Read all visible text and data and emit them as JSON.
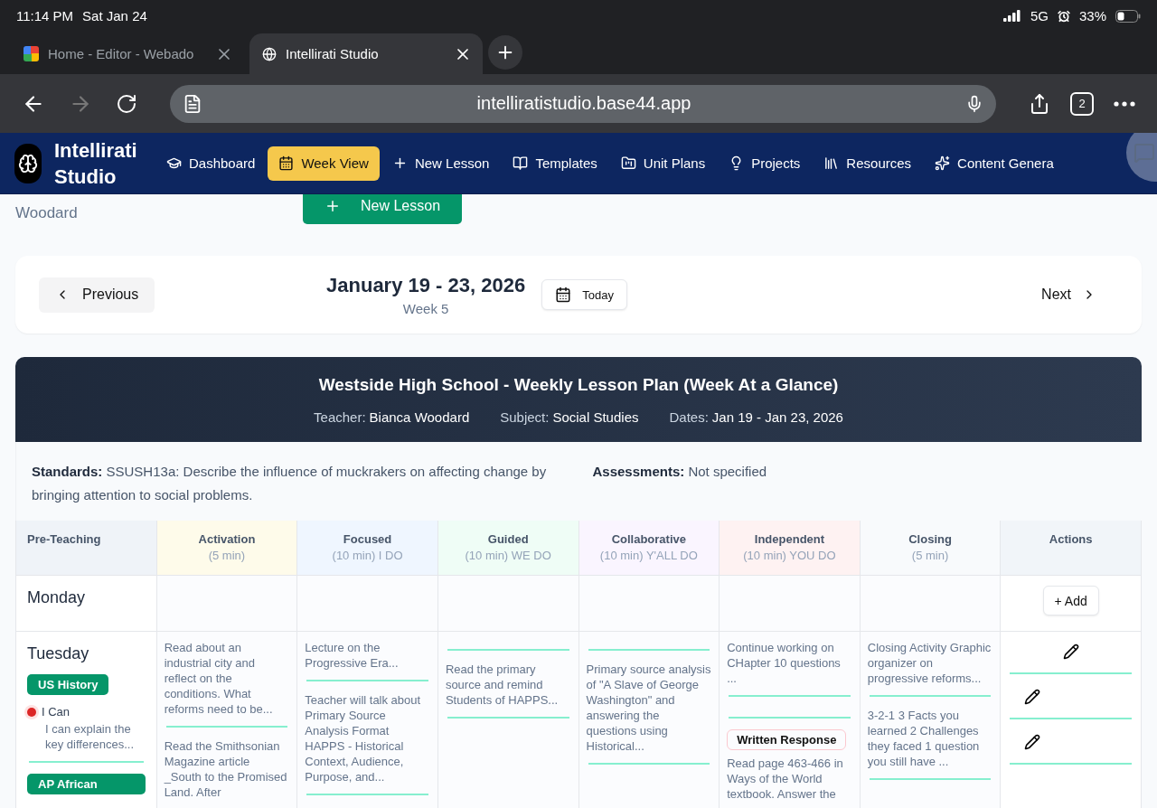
{
  "status_bar": {
    "time": "11:14 PM",
    "date": "Sat Jan 24",
    "network": "5G",
    "battery": "33%"
  },
  "browser": {
    "tabs": [
      {
        "title": "Home - Editor - Webado",
        "selected": false,
        "kind": "site"
      },
      {
        "title": "Intellirati Studio",
        "selected": true,
        "kind": "globe"
      }
    ],
    "url": "intelliratistudio.base44.app",
    "tab_count": "2"
  },
  "app_nav": {
    "brand": "Intellirati Studio",
    "items": [
      {
        "label": "Dashboard",
        "selected": false
      },
      {
        "label": "Week View",
        "selected": true
      },
      {
        "label": "New Lesson",
        "selected": false
      },
      {
        "label": "Templates",
        "selected": false
      },
      {
        "label": "Unit Plans",
        "selected": false
      },
      {
        "label": "Projects",
        "selected": false
      },
      {
        "label": "Resources",
        "selected": false
      },
      {
        "label": "Content Genera",
        "selected": false
      }
    ]
  },
  "page_header": {
    "subtitle": "Woodard",
    "new_lesson_button": "New Lesson"
  },
  "week_nav": {
    "previous": "Previous",
    "title": "January 19 - 23, 2026",
    "week": "Week 5",
    "today": "Today",
    "next": "Next"
  },
  "plan": {
    "title": "Westside High School - Weekly Lesson Plan (Week At a Glance)",
    "meta": [
      {
        "label": "Teacher:",
        "value": "Bianca Woodard"
      },
      {
        "label": "Subject:",
        "value": "Social Studies"
      },
      {
        "label": "Dates:",
        "value": "Jan 19 - Jan 23, 2026"
      }
    ],
    "standards": "**Standards:** SSUSH13a: Describe the influence of muckrakers on affecting change by bringing attention to social problems.",
    "assessments": "**Assessments:** Not specified"
  },
  "table": {
    "columns": [
      {
        "name": "Pre-Teaching",
        "color": "#eff3f8"
      },
      {
        "name": "Activation",
        "detail": "(5 min)",
        "color": "#fefbea"
      },
      {
        "name": "Focused",
        "detail": "(10 min) I DO",
        "color": "#eff6ff"
      },
      {
        "name": "Guided",
        "detail": "(10 min) WE DO",
        "color": "#effdf6"
      },
      {
        "name": "Collaborative",
        "detail": "(10 min) Y'ALL DO",
        "color": "#faf5ff"
      },
      {
        "name": "Independent",
        "detail": "(10 min) YOU DO",
        "color": "#fef2f2"
      },
      {
        "name": "Closing",
        "detail": "(5 min)",
        "color": "#f8fafc"
      },
      {
        "name": "Actions",
        "color": "#f1f5f9"
      }
    ],
    "rows": [
      {
        "cells": [
          {
            "day": "Monday"
          },
          {},
          {},
          {},
          {},
          {},
          {},
          {
            "actions": [
              {
                "kind": "add",
                "label": "+ Add"
              }
            ]
          }
        ]
      },
      {
        "cells": [
          {
            "day": "Tuesday",
            "courses": [
              {
                "name": "US History",
                "objectives": [
                  {
                    "label": "I Can",
                    "text": "I can explain the key differences...",
                    "color": "#dc2626"
                  }
                ]
              },
              {
                "name": "AP African"
              }
            ]
          },
          {
            "entries": [
              {
                "kind": "text",
                "text": "Read about an industrial city and reflect on the conditions. What reforms need to be..."
              },
              {
                "kind": "text",
                "text": "Read the Smithsonian Magazine article _South to the Promised Land. After"
              }
            ]
          },
          {
            "entries": [
              {
                "kind": "text",
                "text": "Lecture on the Progressive Era..."
              },
              {
                "kind": "text",
                "text": "Teacher will talk about Primary Source Analysis Format HAPPS - Historical Context, Audience, Purpose, and..."
              }
            ]
          },
          {
            "entries": [
              {
                "kind": "blank"
              },
              {
                "kind": "text",
                "text": "Read the primary source and remind Students of HAPPS..."
              }
            ]
          },
          {
            "entries": [
              {
                "kind": "blank"
              },
              {
                "kind": "text",
                "text": "Primary source analysis of \"A Slave of George Washington\" and answering the questions using Historical..."
              }
            ]
          },
          {
            "entries": [
              {
                "kind": "text",
                "text": "Continue working on CHapter 10 questions ..."
              },
              {
                "kind": "blank"
              },
              {
                "kind": "tagged",
                "tag": "Written Response",
                "text": "Read page 463-466 in Ways of the World textbook. Answer the"
              }
            ]
          },
          {
            "entries": [
              {
                "kind": "text",
                "text": "Closing Activity Graphic organizer on progressive reforms..."
              },
              {
                "kind": "text",
                "text": "3-2-1 3 Facts you learned 2 Challenges they faced 1 question you still have ..."
              }
            ]
          },
          {
            "actions": [
              {
                "kind": "edit"
              },
              {
                "kind": "edit"
              },
              {
                "kind": "edit"
              }
            ]
          }
        ]
      }
    ]
  }
}
